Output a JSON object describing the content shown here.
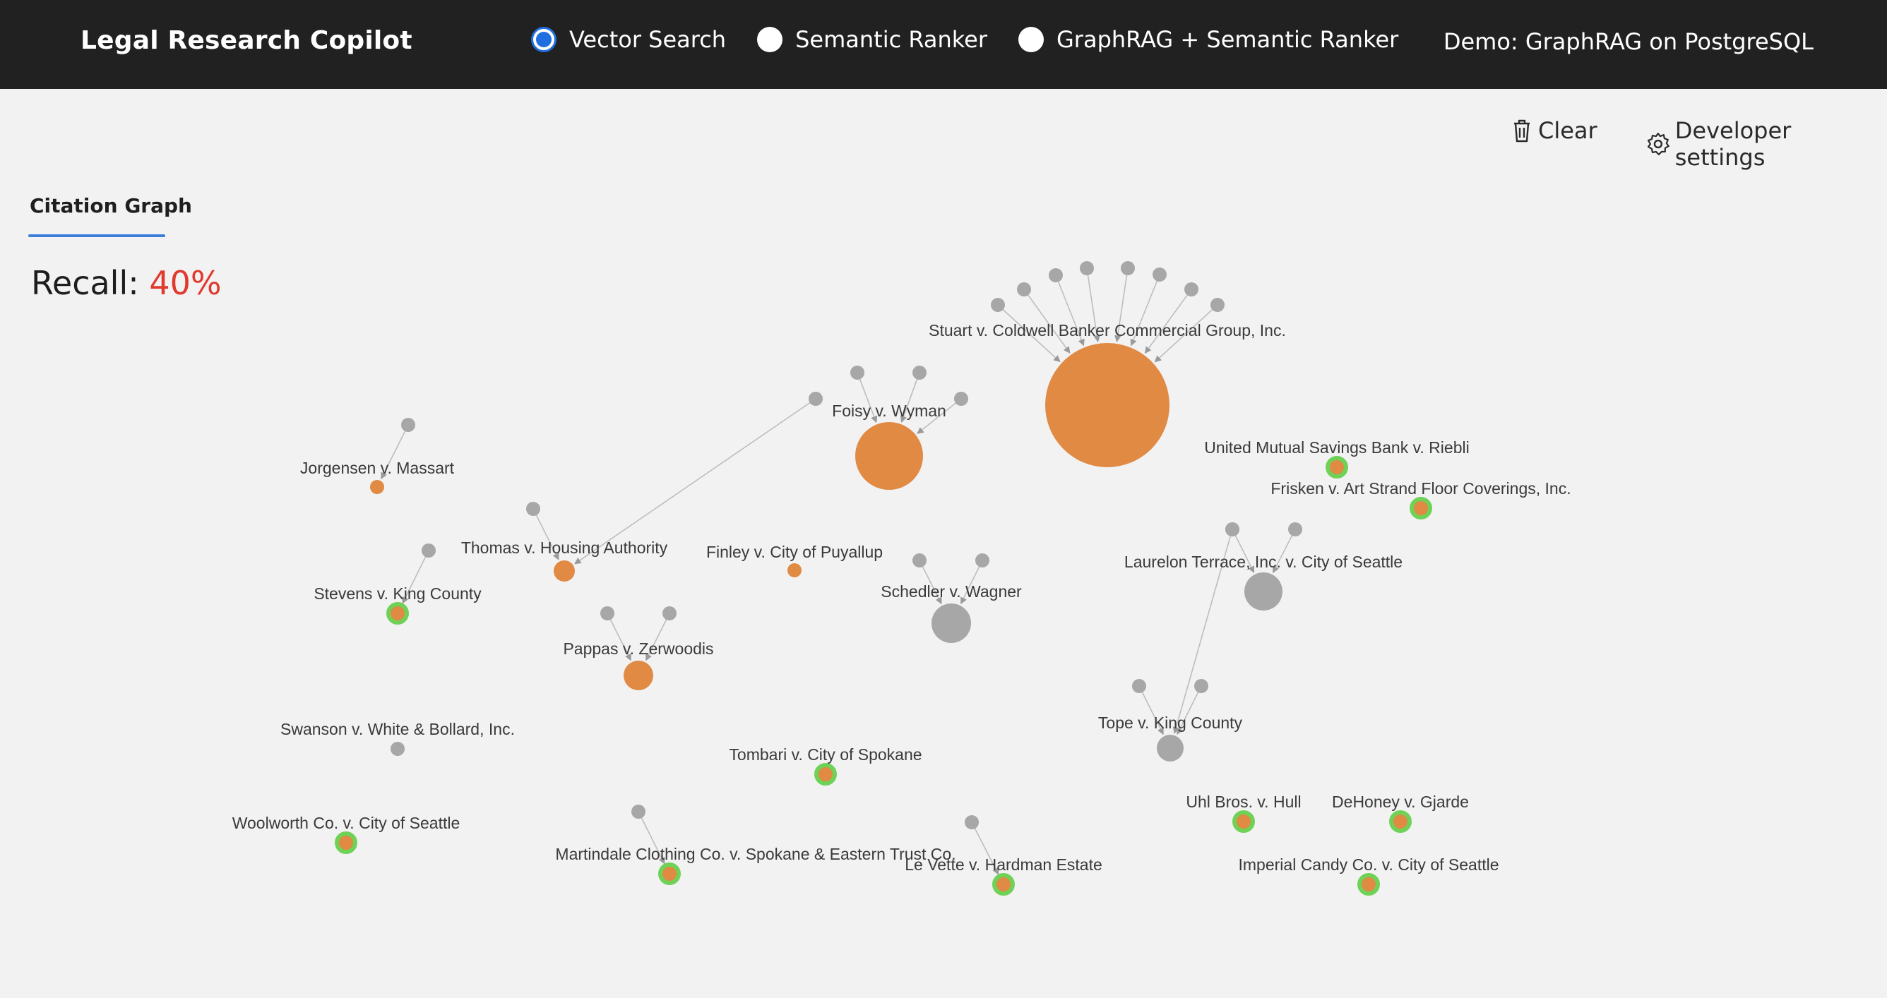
{
  "header": {
    "title": "Legal Research Copilot",
    "modes": [
      {
        "label": "Vector Search",
        "selected": true
      },
      {
        "label": "Semantic Ranker",
        "selected": false
      },
      {
        "label": "GraphRAG + Semantic Ranker",
        "selected": false
      }
    ],
    "demo_label": "Demo: GraphRAG on PostgreSQL"
  },
  "toolbar": {
    "clear_label": "Clear",
    "clear_icon": "trash-icon",
    "settings_label": "Developer settings",
    "settings_icon": "gear-icon"
  },
  "tabs": [
    {
      "label": "Citation Graph",
      "active": true
    }
  ],
  "recall": {
    "label": "Recall:",
    "value": "40%"
  },
  "colors": {
    "accent": "#1f6fe0",
    "retrieved": "#e08a44",
    "relevant_ring": "#6fd257",
    "unrelated": "#a7a7a7",
    "recall_value": "#e0392d",
    "edge": "#bdbdbd"
  },
  "graph": {
    "labeled_nodes": [
      {
        "label": "Stuart v. Coldwell Banker Commercial Group, Inc.",
        "kind": "retrieved"
      },
      {
        "label": "Foisy v. Wyman",
        "kind": "retrieved"
      },
      {
        "label": "Jorgensen v. Massart",
        "kind": "retrieved"
      },
      {
        "label": "Thomas v. Housing Authority",
        "kind": "retrieved"
      },
      {
        "label": "Finley v. City of Puyallup",
        "kind": "retrieved"
      },
      {
        "label": "Pappas v. Zerwoodis",
        "kind": "retrieved"
      },
      {
        "label": "Stevens v. King County",
        "kind": "relevant"
      },
      {
        "label": "United Mutual Savings Bank v. Riebli",
        "kind": "relevant"
      },
      {
        "label": "Frisken v. Art Strand Floor Coverings, Inc.",
        "kind": "relevant"
      },
      {
        "label": "Laurelon Terrace, Inc. v. City of Seattle",
        "kind": "other"
      },
      {
        "label": "Schedler v. Wagner",
        "kind": "other"
      },
      {
        "label": "Tope v. King County",
        "kind": "other"
      },
      {
        "label": "Swanson v. White & Bollard, Inc.",
        "kind": "other"
      },
      {
        "label": "Tombari v. City of Spokane",
        "kind": "relevant"
      },
      {
        "label": "Woolworth Co. v. City of Seattle",
        "kind": "relevant"
      },
      {
        "label": "Martindale Clothing Co. v. Spokane & Eastern Trust Co.",
        "kind": "relevant"
      },
      {
        "label": "Le Vette v. Hardman Estate",
        "kind": "relevant"
      },
      {
        "label": "Uhl Bros. v. Hull",
        "kind": "relevant"
      },
      {
        "label": "DeHoney v. Gjarde",
        "kind": "relevant"
      },
      {
        "label": "Imperial Candy Co. v. City of Seattle",
        "kind": "relevant"
      }
    ]
  }
}
